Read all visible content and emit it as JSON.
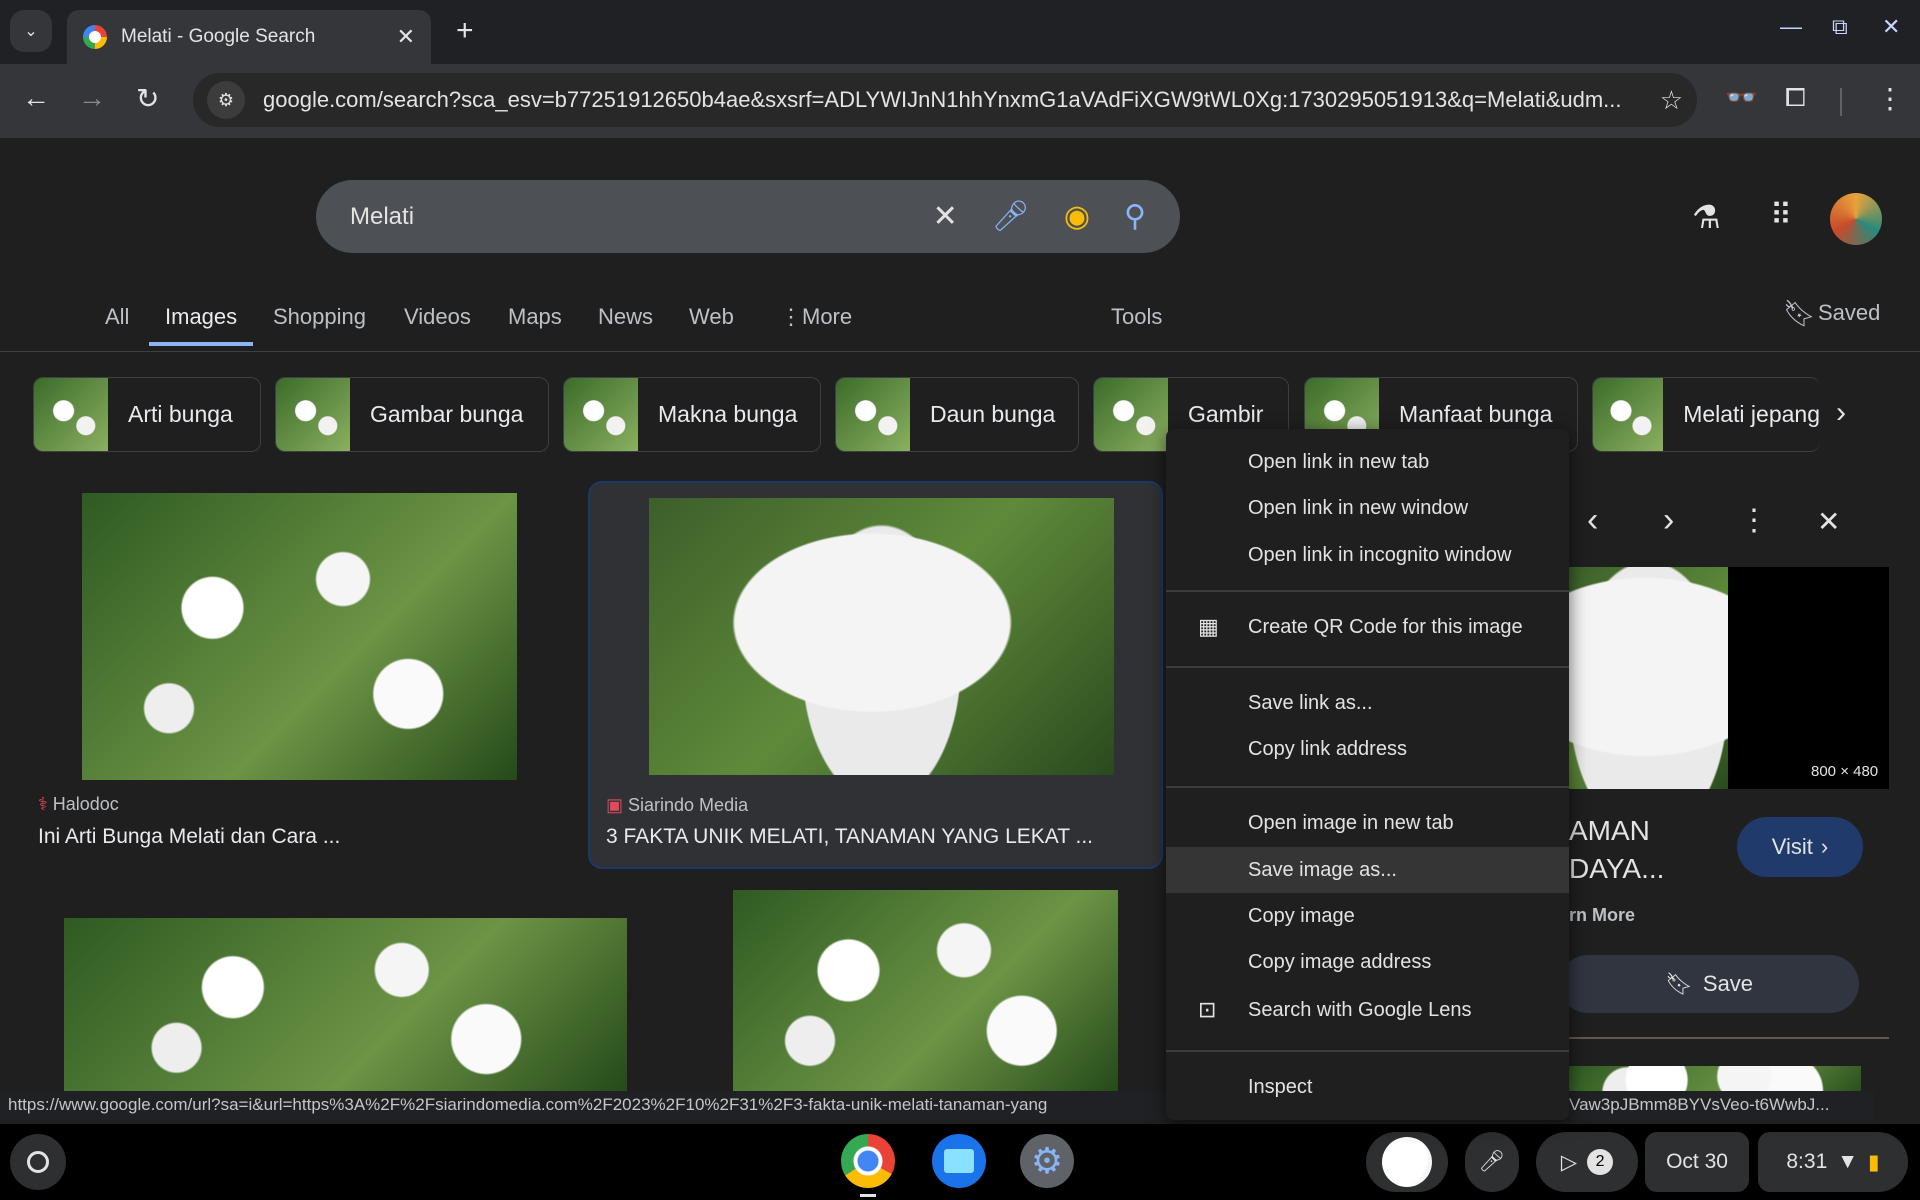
{
  "browser": {
    "tab_title": "Melati - Google Search",
    "url": "google.com/search?sca_esv=b77251912650b4ae&sxsrf=ADLYWIJnN1hhYnxmG1aVAdFiXGW9tWL0Xg:1730295051913&q=Melati&udm...",
    "new_tab": "+"
  },
  "search": {
    "query": "Melati"
  },
  "nav_tabs": [
    "All",
    "Images",
    "Shopping",
    "Videos",
    "Maps",
    "News",
    "Web",
    "More",
    "Tools"
  ],
  "saved_label": "Saved",
  "chips": [
    "Arti bunga",
    "Gambar bunga",
    "Makna bunga",
    "Daun bunga",
    "Gambir",
    "Manfaat bunga",
    "Melati jepang"
  ],
  "results": [
    {
      "source": "Halodoc",
      "title": "Ini Arti Bunga Melati dan Cara ..."
    },
    {
      "source": "Siarindo Media",
      "title": "3 FAKTA UNIK MELATI, TANAMAN YANG LEKAT ..."
    }
  ],
  "panel": {
    "dimensions": "800 × 480",
    "title_line1": "AMAN",
    "title_line2": "DAYA...",
    "learn_more": "rn More",
    "visit": "Visit",
    "save": "Save"
  },
  "context_menu": [
    "Open link in new tab",
    "Open link in new window",
    "Open link in incognito window",
    "Create QR Code for this image",
    "Save link as...",
    "Copy link address",
    "Open image in new tab",
    "Save image as...",
    "Copy image",
    "Copy image address",
    "Search with Google Lens",
    "Inspect"
  ],
  "status_url": "https://www.google.com/url?sa=i&url=https%3A%2F%2Fsiarindomedia.com%2F2023%2F10%2F31%2F3-fakta-unik-melati-tanaman-yang",
  "status_url_tail": "Vaw3pJBmm8BYVsVeo-t6WwbJ...",
  "shelf": {
    "notification_count": "2",
    "date": "Oct 30",
    "time": "8:31"
  },
  "colors": {
    "accent": "#8ab4f8",
    "visit_button": "#1f3a6b",
    "menu_highlight": "#353535"
  }
}
